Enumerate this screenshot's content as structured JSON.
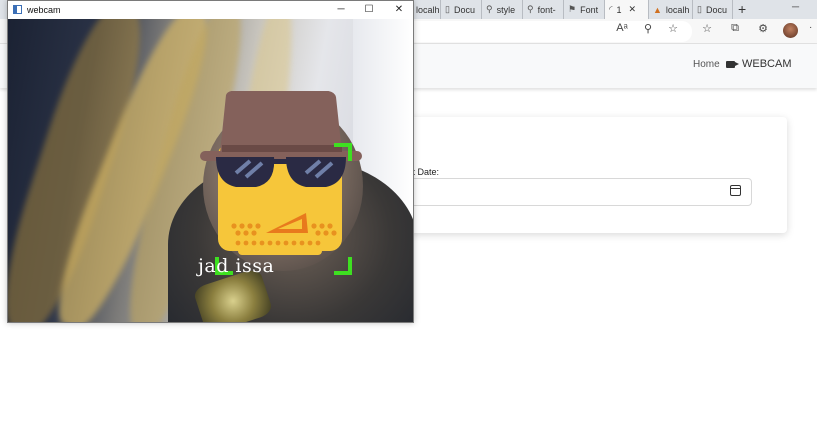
{
  "browser": {
    "tabs": [
      {
        "icon": "page-icon",
        "label": "localh"
      },
      {
        "icon": "page-icon",
        "label": "Docu"
      },
      {
        "icon": "search-icon",
        "label": "style"
      },
      {
        "icon": "search-icon",
        "label": "font-"
      },
      {
        "icon": "flag-icon",
        "label": "Font"
      },
      {
        "icon": "loading-icon",
        "label": "1",
        "active": true
      },
      {
        "icon": "flame-icon",
        "label": "localh"
      },
      {
        "icon": "page-icon",
        "label": "Docu"
      }
    ],
    "nav": {
      "home_label": "Home",
      "webcam_label": "WEBCAM"
    },
    "form": {
      "date_label": "ct Date:"
    }
  },
  "webcam_window": {
    "title": "webcam",
    "minimize": "─",
    "maximize": "☐",
    "close": "✕",
    "face_label": "jad issa"
  },
  "colors": {
    "detection_box": "#3ee021",
    "emoji_face": "#f6c63a",
    "hat": "#84615b"
  }
}
